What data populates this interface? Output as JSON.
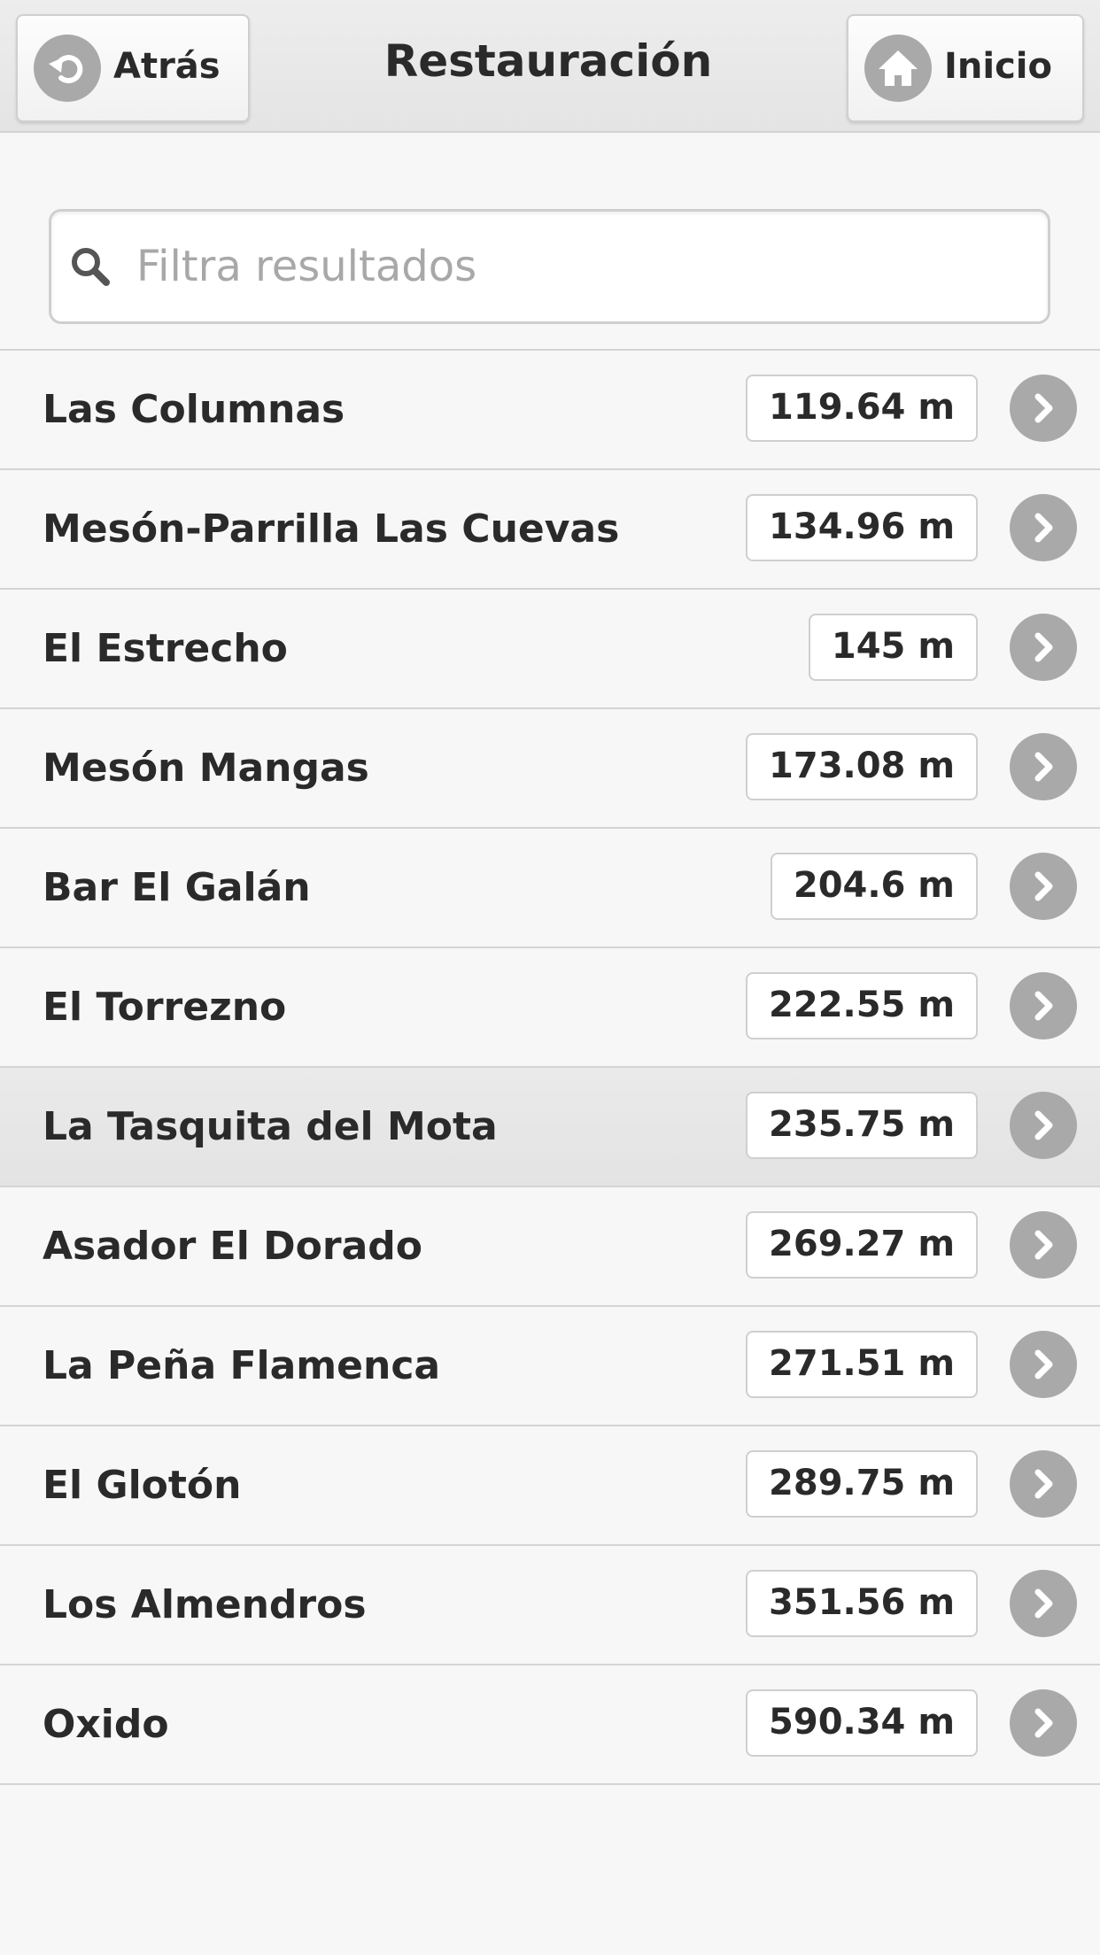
{
  "header": {
    "title": "Restauración",
    "back_label": "Atrás",
    "home_label": "Inicio"
  },
  "search": {
    "placeholder": "Filtra resultados",
    "value": ""
  },
  "list": {
    "selected_index": 6,
    "items": [
      {
        "name": "Las Columnas",
        "distance": "119.64 m"
      },
      {
        "name": "Mesón-Parrilla Las Cuevas",
        "distance": "134.96 m"
      },
      {
        "name": "El Estrecho",
        "distance": "145 m"
      },
      {
        "name": "Mesón Mangas",
        "distance": "173.08 m"
      },
      {
        "name": "Bar El Galán",
        "distance": "204.6 m"
      },
      {
        "name": "El Torrezno",
        "distance": "222.55 m"
      },
      {
        "name": "La Tasquita del Mota",
        "distance": "235.75 m"
      },
      {
        "name": "Asador El Dorado",
        "distance": "269.27 m"
      },
      {
        "name": "La Peña Flamenca",
        "distance": "271.51 m"
      },
      {
        "name": "El Glotón",
        "distance": "289.75 m"
      },
      {
        "name": "Los Almendros",
        "distance": "351.56 m"
      },
      {
        "name": "Oxido",
        "distance": "590.34 m"
      }
    ]
  },
  "icons": {
    "back": "back-arrow-icon",
    "home": "home-icon",
    "search": "search-icon",
    "row_arrow": "chevron-right-icon"
  },
  "colors": {
    "icon_gray": "#a9a9a9",
    "header_bg": "#e8e8e8",
    "page_bg": "#f7f7f7",
    "text": "#2a2a2a"
  }
}
